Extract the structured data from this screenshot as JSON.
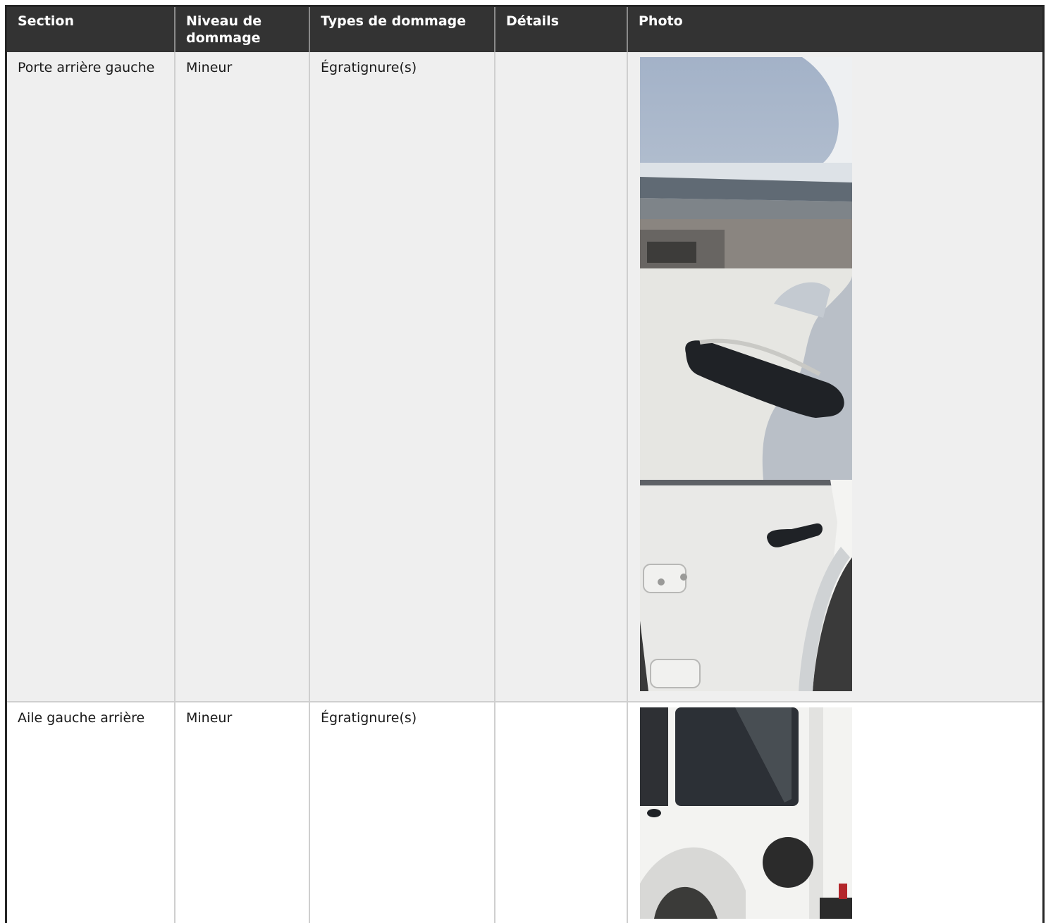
{
  "table": {
    "headers": [
      "Section",
      "Niveau de dommage",
      "Types de dommage",
      "Détails",
      "Photo"
    ],
    "rows": [
      {
        "section": "Porte arrière gauche",
        "level": "Mineur",
        "types": "Égratignure(s)",
        "details": "",
        "photos": [
          "door-edge-photo",
          "door-handle-photo",
          "rear-door-photo"
        ]
      },
      {
        "section": "Aile gauche arrière",
        "level": "Mineur",
        "types": "Égratignure(s)",
        "details": "",
        "photos": [
          "rear-quarter-photo"
        ]
      }
    ]
  }
}
